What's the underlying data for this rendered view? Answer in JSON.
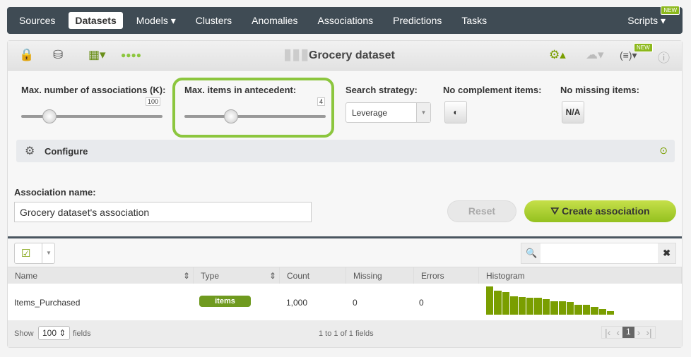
{
  "nav": {
    "items": [
      "Sources",
      "Datasets",
      "Models ▾",
      "Clusters",
      "Anomalies",
      "Associations",
      "Predictions",
      "Tasks"
    ],
    "scripts": "Scripts ▾",
    "new_badge": "NEW"
  },
  "toolbar": {
    "title": "Grocery dataset",
    "new_badge": "NEW"
  },
  "params": {
    "max_assoc_label": "Max. number of associations (K):",
    "max_assoc_value": "100",
    "max_assoc_pct": 0.2,
    "max_items_label": "Max. items in antecedent:",
    "max_items_value": "4",
    "max_items_pct": 0.33,
    "search_label": "Search strategy:",
    "search_value": "Leverage",
    "complement_label": "No complement items:",
    "missing_label": "No missing items:",
    "missing_btn": "N/A"
  },
  "configure": {
    "label": "Configure"
  },
  "form": {
    "name_label": "Association name:",
    "name_value": "Grocery dataset's association",
    "reset": "Reset",
    "create": "Create association"
  },
  "table": {
    "headers": [
      "Name",
      "Type",
      "Count",
      "Missing",
      "Errors",
      "Histogram"
    ],
    "rows": [
      {
        "name": "Items_Purchased",
        "type": "items",
        "count": "1,000",
        "missing": "0",
        "errors": "0",
        "histogram": [
          40,
          34,
          32,
          26,
          25,
          24,
          24,
          22,
          19,
          19,
          18,
          14,
          14,
          11,
          8,
          5
        ]
      }
    ]
  },
  "footer": {
    "show": "Show",
    "page_size": "100",
    "fields": "fields",
    "summary": "1 to 1 of 1 fields",
    "page": "1"
  },
  "colors": {
    "accent": "#8cc63e",
    "nav": "#3f4b54",
    "histogram": "#7a9e00"
  }
}
